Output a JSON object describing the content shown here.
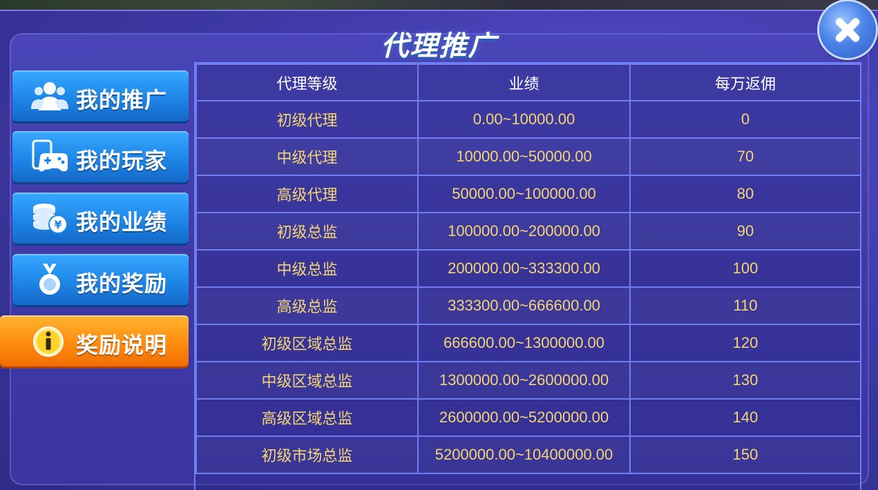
{
  "title": "代理推广",
  "close_icon": "close-icon",
  "sidebar": {
    "items": [
      {
        "label": "我的推广",
        "icon": "users-icon",
        "active": false
      },
      {
        "label": "我的玩家",
        "icon": "gamepad-icon",
        "active": false
      },
      {
        "label": "我的业绩",
        "icon": "coins-icon",
        "active": false
      },
      {
        "label": "我的奖励",
        "icon": "medal-icon",
        "active": false
      },
      {
        "label": "奖励说明",
        "icon": "info-icon",
        "active": true
      }
    ]
  },
  "colors": {
    "active_tab": "#ff9a1a",
    "inactive_tab": "#1e86e8",
    "value_text": "#f4d572",
    "grid": "#6f7ff2"
  },
  "table": {
    "headers": [
      "代理等级",
      "业绩",
      "每万返佣"
    ],
    "rows": [
      [
        "初级代理",
        "0.00~10000.00",
        "0"
      ],
      [
        "中级代理",
        "10000.00~50000.00",
        "70"
      ],
      [
        "高级代理",
        "50000.00~100000.00",
        "80"
      ],
      [
        "初级总监",
        "100000.00~200000.00",
        "90"
      ],
      [
        "中级总监",
        "200000.00~333300.00",
        "100"
      ],
      [
        "高级总监",
        "333300.00~666600.00",
        "110"
      ],
      [
        "初级区域总监",
        "666600.00~1300000.00",
        "120"
      ],
      [
        "中级区域总监",
        "1300000.00~2600000.00",
        "130"
      ],
      [
        "高级区域总监",
        "2600000.00~5200000.00",
        "140"
      ],
      [
        "初级市场总监",
        "5200000.00~10400000.00",
        "150"
      ]
    ]
  }
}
